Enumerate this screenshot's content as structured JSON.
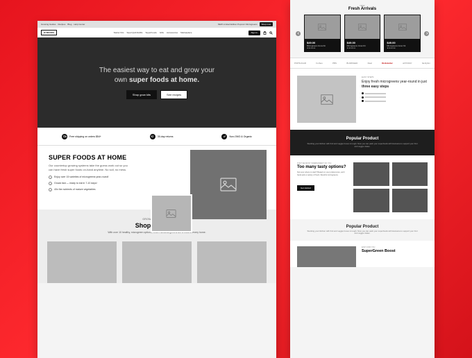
{
  "left": {
    "topbar": {
      "links": [
        "Growing Guides",
        "Recipes",
        "Blog",
        "Help Center"
      ],
      "promo": "NEW Limited Edition Popcorn Microgreens",
      "cta": "Shop now"
    },
    "nav": {
      "logo": "HAMAMA",
      "links": [
        "Starter Kits",
        "Seed Quilt Refills",
        "SuperFoods",
        "Gifts",
        "Accessories",
        "Marketplace"
      ],
      "signin": "Sign In"
    },
    "hero": {
      "line1": "The easiest way to eat and grow your",
      "line2_pre": "own ",
      "line2_bold": "super foods at home.",
      "btn1": "Shop grow kits",
      "btn2": "See recipes"
    },
    "badges": {
      "b1": "Free shipping on orders $54+",
      "b2": "30-day returns",
      "b3": "Non-GMO & Organic"
    },
    "sfh": {
      "heading": "SUPER FOODS AT HOME",
      "desc": "Our countertop growing systems take the guess work out so you can have fresh super foods on-hand anytime. No soil, no mess.",
      "f1": "Enjoy over 15 varieties of microgreens year-round!",
      "f2": "Grows fast — ready to eat in 7-10 days!",
      "f3": "40x the nutrients of mature vegetables"
    },
    "shop": {
      "over": "GROWER FAVORITES",
      "heading": "Shop Hamama",
      "desc": "With over 10 healthy, microgreen options, fresh Hamama greens are a must in every home."
    }
  },
  "right": {
    "fresh": {
      "over": "NEW",
      "heading": "Fresh Arrivals",
      "price": "$49.00",
      "name": "Microgreens Grow Kit",
      "stars": "★★★★★"
    },
    "press": [
      "POPSUGAR",
      "Forbes",
      "PBS",
      "BUZZFEED",
      "Real",
      "Kickstarter",
      "abTODAY",
      "familyfun"
    ],
    "steps": {
      "over": "EASY STEPS",
      "text_pre": "Enjoy fresh microgreens year-round in just ",
      "text_bold": "three easy steps"
    },
    "pop": {
      "heading": "Popular Product",
      "desc": "Stocking your kitchen with fruit and veggie boxes is tough. Now you can pack your superfoods with Hamama to support your fruit and veggie intake."
    },
    "tasty": {
      "over": "FOR THE MOST INDEPENDENT OF YOU",
      "heading": "Too many tasty options?",
      "desc": "Not sure where to start? Based on your preferences, we'll hand-pick a variety of fresh, flavorful microgreens.",
      "btn": "Get started"
    },
    "pop2": {
      "heading": "Popular Product",
      "desc": "Stocking your kitchen with fruit and veggie boxes is tough. Now you can pack your superfoods with Hamama to support your fruit and veggie intake."
    },
    "boost": {
      "over": "EASY FOR YOU",
      "heading": "SuperGreen Boost"
    }
  }
}
